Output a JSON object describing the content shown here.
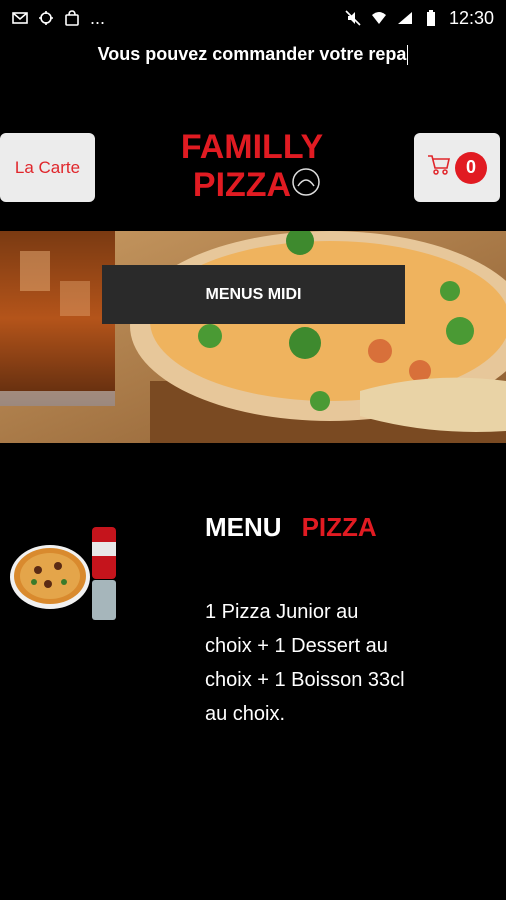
{
  "status_bar": {
    "time": "12:30",
    "more": "...",
    "left_icons": [
      "mail-icon",
      "sync-icon",
      "bag-icon"
    ],
    "right_icons": [
      "mute-icon",
      "wifi-icon",
      "signal-icon",
      "battery-icon"
    ]
  },
  "ticker": {
    "text": "Vous pouvez commander votre repa"
  },
  "header": {
    "carte_label": "La Carte",
    "cart_count": "0",
    "logo_line1": "FAMILLY",
    "logo_line2": "PIZZA"
  },
  "banner": {
    "button_label": "MENUS MIDI"
  },
  "menu": {
    "title_word1": "MENU",
    "title_word2": "PIZZA",
    "description": "1 Pizza Junior au choix + 1 Dessert au choix + 1 Boisson 33cl au choix."
  },
  "colors": {
    "brand_red": "#e11b22",
    "background": "#000000",
    "button_light": "#ececec",
    "button_dark": "#2a2a2a"
  }
}
